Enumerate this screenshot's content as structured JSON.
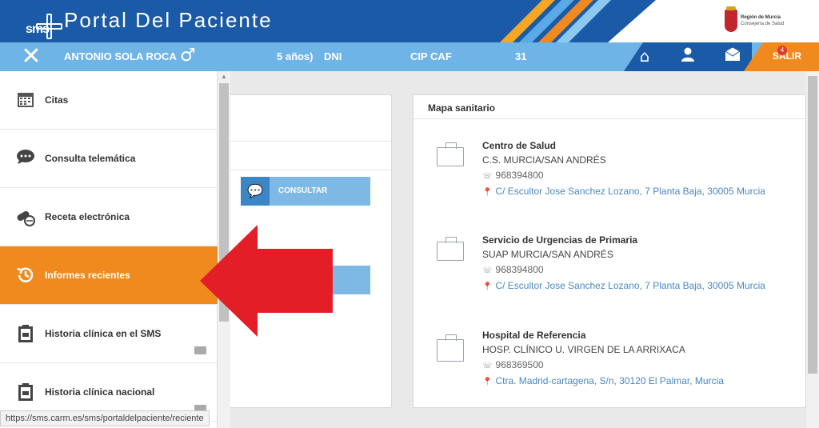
{
  "header": {
    "logo_text": "sms",
    "title": "Portal Del Paciente",
    "region_line1": "Región de Murcia",
    "region_line2": "Consejería de Salud"
  },
  "userbar": {
    "name": "ANTONIO SOLA ROCA",
    "age": "5 años)",
    "dni_label": "DNI",
    "cip_label": "CIP CAF",
    "cip_value_tail": "31",
    "logout_label": "SALIR",
    "notification_count": "4"
  },
  "sidemenu": {
    "items": [
      {
        "label": "Citas",
        "icon": "calendar-icon"
      },
      {
        "label": "Consulta telemática",
        "icon": "chat-icon"
      },
      {
        "label": "Receta electrónica",
        "icon": "pills-icon"
      },
      {
        "label": "Informes recientes",
        "icon": "history-icon"
      },
      {
        "label": "Historia clínica en el SMS",
        "icon": "clipboard-icon"
      },
      {
        "label": "Historia clínica nacional",
        "icon": "clipboard-icon"
      }
    ],
    "active_index": 3
  },
  "consult": {
    "button_label": "CONSULTAR"
  },
  "mapa": {
    "title": "Mapa sanitario",
    "centers": [
      {
        "title": "Centro de Salud",
        "name": "C.S. MURCIA/SAN ANDRÉS",
        "phone": "968394800",
        "address": "C/ Escultor Jose Sanchez Lozano, 7 Planta Baja, 30005 Murcia"
      },
      {
        "title": "Servicio de Urgencias de Primaria",
        "name": "SUAP MURCIA/SAN ANDRÉS",
        "phone": "968394800",
        "address": "C/ Escultor Jose Sanchez Lozano, 7 Planta Baja, 30005 Murcia"
      },
      {
        "title": "Hospital de Referencia",
        "name": "HOSP. CLÍNICO U. VIRGEN DE LA ARRIXACA",
        "phone": "968369500",
        "address": "Ctra. Madrid-cartagena, S/n, 30120 El Palmar, Murcia"
      }
    ]
  },
  "status": {
    "url": "https://sms.carm.es/sms/portaldelpaciente/reciente"
  },
  "colors": {
    "blue": "#1a5aa6",
    "light_blue": "#6fb4e6",
    "orange": "#f08a1e",
    "arrow_red": "#e41e26"
  }
}
